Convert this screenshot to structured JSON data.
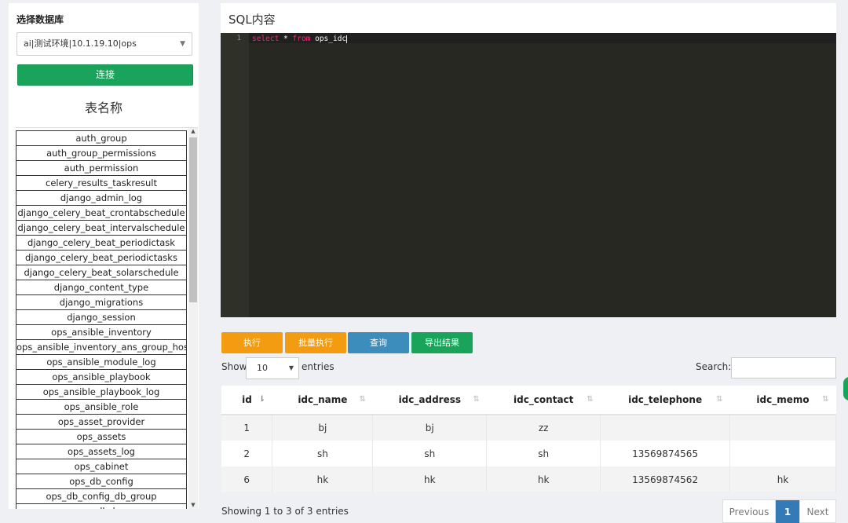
{
  "sidebar": {
    "title": "选择数据库",
    "db_select_value": "ai|测试环境|10.1.19.10|ops",
    "connect_label": "连接",
    "tables_heading": "表名称",
    "tables": [
      "auth_group",
      "auth_group_permissions",
      "auth_permission",
      "celery_results_taskresult",
      "django_admin_log",
      "django_celery_beat_crontabschedule",
      "django_celery_beat_intervalschedule",
      "django_celery_beat_periodictask",
      "django_celery_beat_periodictasks",
      "django_celery_beat_solarschedule",
      "django_content_type",
      "django_migrations",
      "django_session",
      "ops_ansible_inventory",
      "ops_ansible_inventory_ans_group_hosts",
      "ops_ansible_module_log",
      "ops_ansible_playbook",
      "ops_ansible_playbook_log",
      "ops_ansible_role",
      "ops_asset_provider",
      "ops_assets",
      "ops_assets_log",
      "ops_cabinet",
      "ops_db_config",
      "ops_db_config_db_group",
      "ops_db_log"
    ]
  },
  "editor": {
    "header": "SQL内容",
    "line_number": "1",
    "kw_select": "select",
    "star": " * ",
    "kw_from": "from",
    "table_name": " ops_idc"
  },
  "actions": {
    "execute": "执行",
    "batch_execute": "批量执行",
    "query": "查询",
    "export": "导出结果"
  },
  "table_controls": {
    "show": "Show",
    "page_length": "10",
    "entries": "entries",
    "search": "Search:"
  },
  "result": {
    "columns": [
      "id",
      "idc_name",
      "idc_address",
      "idc_contact",
      "idc_telephone",
      "idc_memo"
    ],
    "rows": [
      [
        "1",
        "bj",
        "bj",
        "zz",
        "",
        ""
      ],
      [
        "2",
        "sh",
        "sh",
        "sh",
        "13569874565",
        ""
      ],
      [
        "6",
        "hk",
        "hk",
        "hk",
        "13569874562",
        "hk"
      ]
    ]
  },
  "footer": {
    "info": "Showing 1 to 3 of 3 entries",
    "previous": "Previous",
    "current_page": "1",
    "next": "Next"
  }
}
